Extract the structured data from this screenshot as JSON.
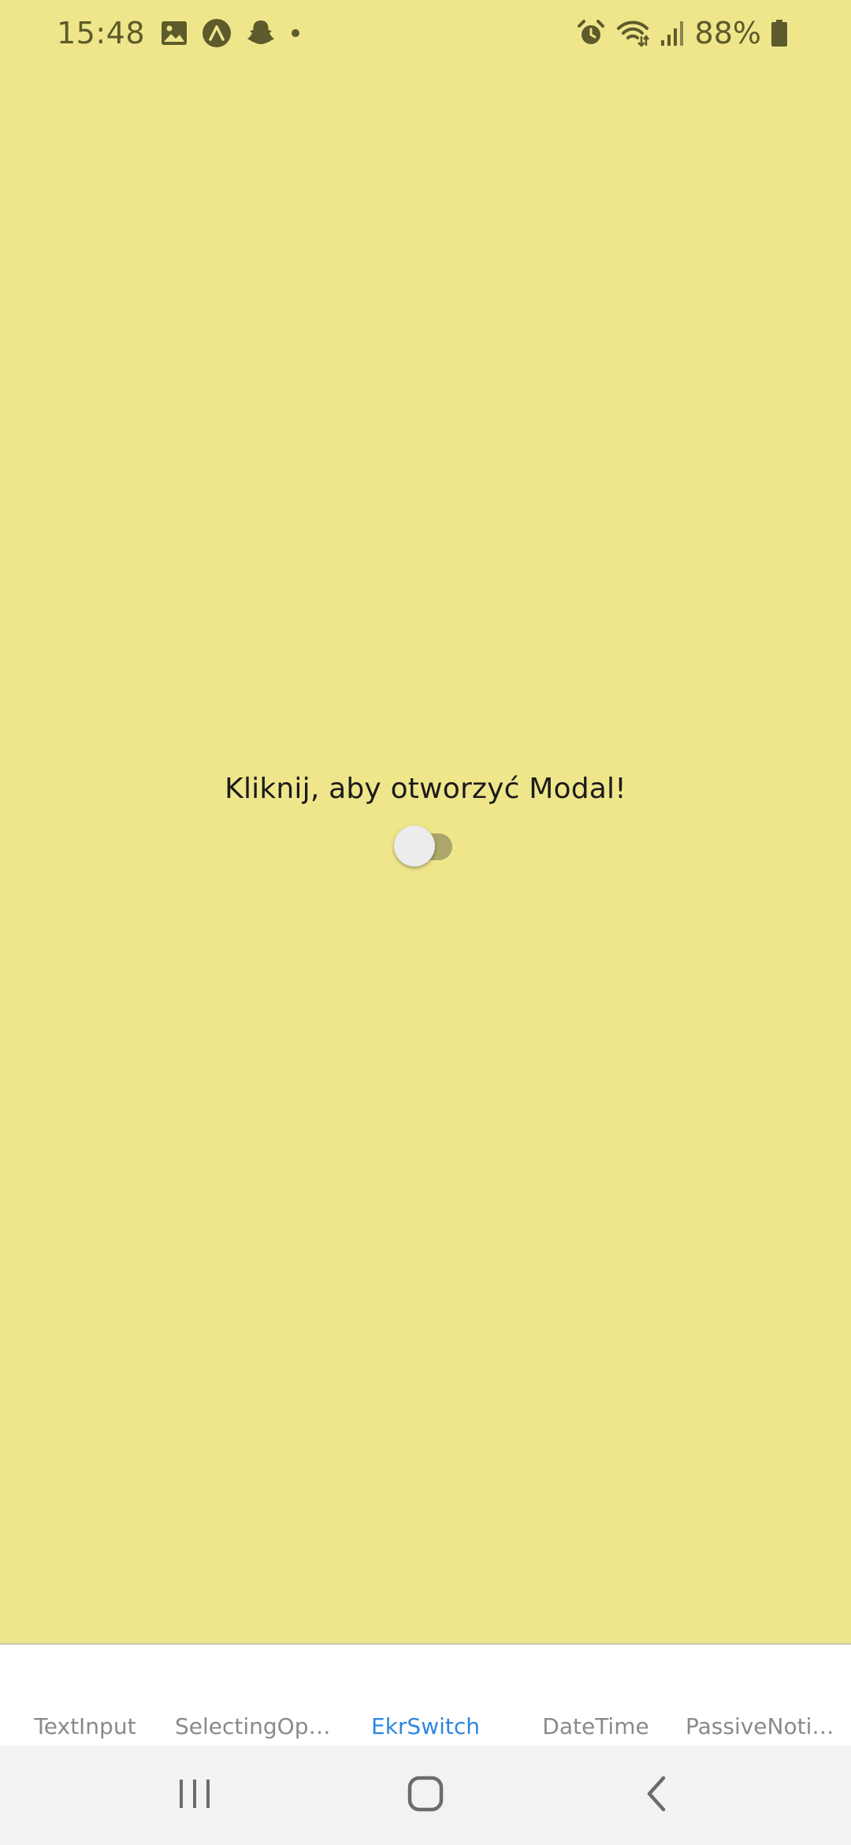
{
  "status_bar": {
    "time": "15:48",
    "left_icons": [
      "image-icon",
      "expo-icon",
      "snapchat-icon",
      "dot-icon"
    ],
    "right_icons": [
      "alarm-icon",
      "wifi-icon",
      "signal-icon",
      "battery-icon"
    ],
    "battery_percent": "88%"
  },
  "main": {
    "prompt": "Kliknij, aby otworzyć Modal!",
    "switch": {
      "on": false,
      "track_color": "#aba76a",
      "thumb_color": "#ececec"
    },
    "background_color": "#efe68b"
  },
  "tab_bar": {
    "tabs": [
      {
        "label": "TextInput",
        "active": false
      },
      {
        "label": "SelectingOpti...",
        "active": false
      },
      {
        "label": "EkrSwitch",
        "active": true
      },
      {
        "label": "DateTime",
        "active": false
      },
      {
        "label": "PassiveNotific...",
        "active": false
      }
    ],
    "active_color": "#2f86e0",
    "inactive_color": "#8a8a8a"
  },
  "nav_bar": {
    "buttons": [
      "recent-apps-icon",
      "home-icon",
      "back-icon"
    ]
  }
}
